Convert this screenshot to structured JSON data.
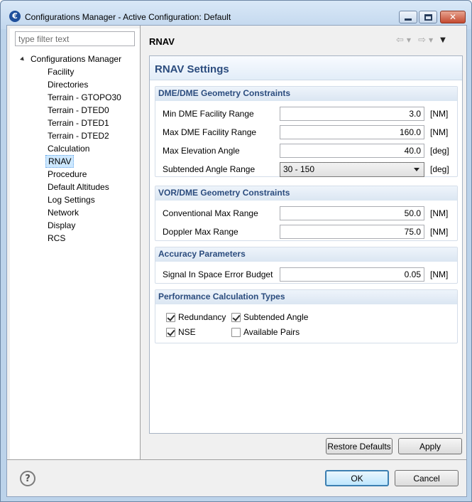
{
  "window": {
    "title": "Configurations Manager - Active Configuration: Default",
    "app_icon_glyph": "€"
  },
  "left": {
    "filter_placeholder": "type filter text",
    "tree_root": "Configurations Manager",
    "tree_items": [
      {
        "label": "Facility",
        "selected": false
      },
      {
        "label": "Directories",
        "selected": false
      },
      {
        "label": "Terrain - GTOPO30",
        "selected": false
      },
      {
        "label": "Terrain - DTED0",
        "selected": false
      },
      {
        "label": "Terrain - DTED1",
        "selected": false
      },
      {
        "label": "Terrain - DTED2",
        "selected": false
      },
      {
        "label": "Calculation",
        "selected": false
      },
      {
        "label": "RNAV",
        "selected": true
      },
      {
        "label": "Procedure",
        "selected": false
      },
      {
        "label": "Default Altitudes",
        "selected": false
      },
      {
        "label": "Log Settings",
        "selected": false
      },
      {
        "label": "Network",
        "selected": false
      },
      {
        "label": "Display",
        "selected": false
      },
      {
        "label": "RCS",
        "selected": false
      }
    ]
  },
  "page": {
    "header_title": "RNAV",
    "settings_title": "RNAV Settings",
    "dme": {
      "title": "DME/DME Geometry Constraints",
      "min_range": {
        "label": "Min DME Facility Range",
        "value": "3.0",
        "unit": "[NM]"
      },
      "max_range": {
        "label": "Max DME Facility Range",
        "value": "160.0",
        "unit": "[NM]"
      },
      "max_elev": {
        "label": "Max Elevation Angle",
        "value": "40.0",
        "unit": "[deg]"
      },
      "subtended": {
        "label": "Subtended Angle Range",
        "value": "30 - 150",
        "unit": "[deg]"
      }
    },
    "vor": {
      "title": "VOR/DME Geometry Constraints",
      "conv_max": {
        "label": "Conventional Max Range",
        "value": "50.0",
        "unit": "[NM]"
      },
      "doppler_max": {
        "label": "Doppler Max Range",
        "value": "75.0",
        "unit": "[NM]"
      }
    },
    "accuracy": {
      "title": "Accuracy Parameters",
      "sis": {
        "label": "Signal In Space Error Budget",
        "value": "0.05",
        "unit": "[NM]"
      }
    },
    "perf": {
      "title": "Performance Calculation Types",
      "redundancy": {
        "label": "Redundancy",
        "checked": true
      },
      "subtended_angle": {
        "label": "Subtended Angle",
        "checked": true
      },
      "nse": {
        "label": "NSE",
        "checked": true
      },
      "available_pairs": {
        "label": "Available Pairs",
        "checked": false
      }
    },
    "restore_label": "Restore Defaults",
    "apply_label": "Apply"
  },
  "footer": {
    "help_glyph": "?",
    "ok_label": "OK",
    "cancel_label": "Cancel"
  }
}
